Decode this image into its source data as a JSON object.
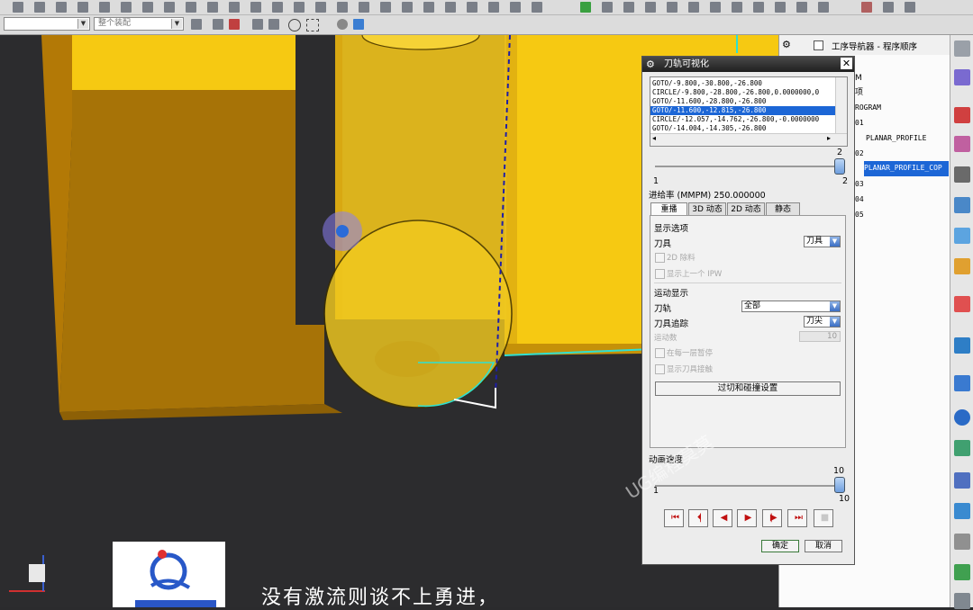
{
  "toolbar": {
    "filter_combo": "",
    "assembly_combo": "整个装配"
  },
  "navigator": {
    "title": "工序导航器 - 程序顺序",
    "items": [
      {
        "label": "M"
      },
      {
        "label": "项"
      },
      {
        "label": "ROGRAM"
      },
      {
        "label": "01"
      },
      {
        "label": "PLANAR_PROFILE"
      },
      {
        "label": "02"
      },
      {
        "label": "PLANAR_PROFILE_COP"
      },
      {
        "label": "03"
      },
      {
        "label": "04"
      },
      {
        "label": "05"
      }
    ]
  },
  "dialog": {
    "title": "刀轨可视化",
    "code_lines": [
      "GOTO/-9.800,-30.800,-26.800",
      "CIRCLE/-9.800,-28.800,-26.800,0.0000000,0",
      "GOTO/-11.600,-28.800,-26.800",
      "GOTO/-11.600,-12.815,-26.800",
      "CIRCLE/-12.057,-14.762,-26.800,-0.0000000",
      "GOTO/-14.004,-14.305,-26.800"
    ],
    "selected_line": 3,
    "slider_top": {
      "value": "2",
      "min": "1",
      "max": "2"
    },
    "feed_rate": "进给率 (MMPM) 250.000000",
    "tabs": [
      "重播",
      "3D 动态",
      "2D 动态",
      "静态"
    ],
    "active_tab": 0,
    "display_options": "显示选项",
    "tool_label": "刀具",
    "tool_value": "刀具",
    "cb_2d_material": "2D 除料",
    "cb_show_prev_ipw": "显示上一个 IPW",
    "motion_display": "运动显示",
    "path_label": "刀轨",
    "path_value": "全部",
    "trace_label": "刀具追踪",
    "trace_value": "刀尖",
    "motion_count_label": "运动数",
    "motion_count_value": "10",
    "cb_pause_each_layer": "在每一层暂停",
    "cb_show_contact": "显示刀具接触",
    "gouge_button": "过切和碰撞设置",
    "anim_speed_label": "动画速度",
    "anim_speed": {
      "value": "10",
      "min": "1",
      "max": "10",
      "fraction": 1.0
    },
    "play_buttons": [
      "⏮",
      "⏴|",
      "◀",
      "▶",
      "|▶",
      "⏭",
      "■"
    ],
    "ok_button": "确定",
    "cancel_button": "取消"
  },
  "overlay": {
    "subtitle": "没有激流则谈不上勇进，",
    "watermark": "UG编程莫莫"
  },
  "colors": {
    "part_yellow": "#f8cd1a",
    "part_side": "#b07a07",
    "tool_path_cyan": "#2fe0d2",
    "selection_blue": "#1c66d6",
    "stop_gray": "#c8c8c8"
  }
}
